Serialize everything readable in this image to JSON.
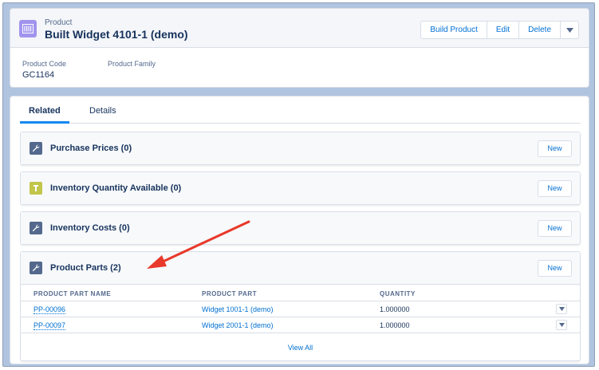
{
  "header": {
    "object_type": "Product",
    "record_title": "Built Widget 4101-1 (demo)",
    "actions": [
      "Build Product",
      "Edit",
      "Delete"
    ],
    "icon": "product-icon",
    "icon_color": "#a094ed"
  },
  "highlights": {
    "fields": [
      {
        "label": "Product Code",
        "value": "GC1164"
      },
      {
        "label": "Product Family",
        "value": ""
      }
    ]
  },
  "tabs": [
    {
      "label": "Related",
      "active": true
    },
    {
      "label": "Details",
      "active": false
    }
  ],
  "related_lists": [
    {
      "title": "Purchase Prices (0)",
      "icon": "wrench-icon",
      "icon_color": "#54698d",
      "new_label": "New"
    },
    {
      "title": "Inventory Quantity Available (0)",
      "icon": "tag-icon",
      "icon_color": "#c2c64a",
      "new_label": "New"
    },
    {
      "title": "Inventory Costs (0)",
      "icon": "wrench-icon",
      "icon_color": "#54698d",
      "new_label": "New"
    },
    {
      "title": "Product Parts (2)",
      "icon": "wrench-icon",
      "icon_color": "#54698d",
      "new_label": "New"
    }
  ],
  "product_parts_table": {
    "columns": [
      "PRODUCT PART NAME",
      "PRODUCT PART",
      "QUANTITY"
    ],
    "rows": [
      {
        "name": "PP-00096",
        "part": "Widget 1001-1 (demo)",
        "quantity": "1.000000"
      },
      {
        "name": "PP-00097",
        "part": "Widget 2001-1 (demo)",
        "quantity": "1.000000"
      }
    ],
    "view_all": "View All"
  },
  "annotation": {
    "color": "#e8392a"
  }
}
